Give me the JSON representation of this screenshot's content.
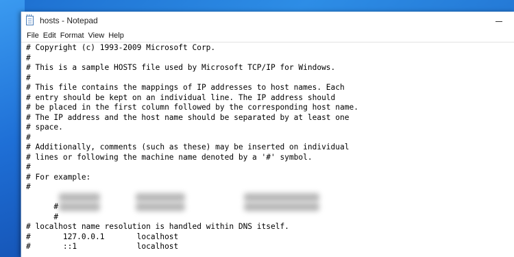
{
  "window": {
    "title": "hosts - Notepad"
  },
  "icons": {
    "app": "notepad-icon",
    "minimize": "minimize-icon"
  },
  "menu": [
    "File",
    "Edit",
    "Format",
    "View",
    "Help"
  ],
  "content": {
    "lines": [
      "# Copyright (c) 1993-2009 Microsoft Corp.",
      "#",
      "# This is a sample HOSTS file used by Microsoft TCP/IP for Windows.",
      "#",
      "# This file contains the mappings of IP addresses to host names. Each",
      "# entry should be kept on an individual line. The IP address should",
      "# be placed in the first column followed by the corresponding host name.",
      "# The IP address and the host name should be separated by at least one",
      "# space.",
      "#",
      "# Additionally, comments (such as these) may be inserted on individual",
      "# lines or following the machine name denoted by a '#' symbol.",
      "#",
      "# For example:",
      "#",
      "#",
      "#",
      "",
      "# localhost name resolution is handled within DNS itself.",
      "#\t127.0.0.1       localhost",
      "#\t::1             localhost"
    ]
  },
  "colors": {
    "desktop_blue": "#1e6fd6",
    "window_bg": "#ffffff",
    "text": "#000000"
  }
}
